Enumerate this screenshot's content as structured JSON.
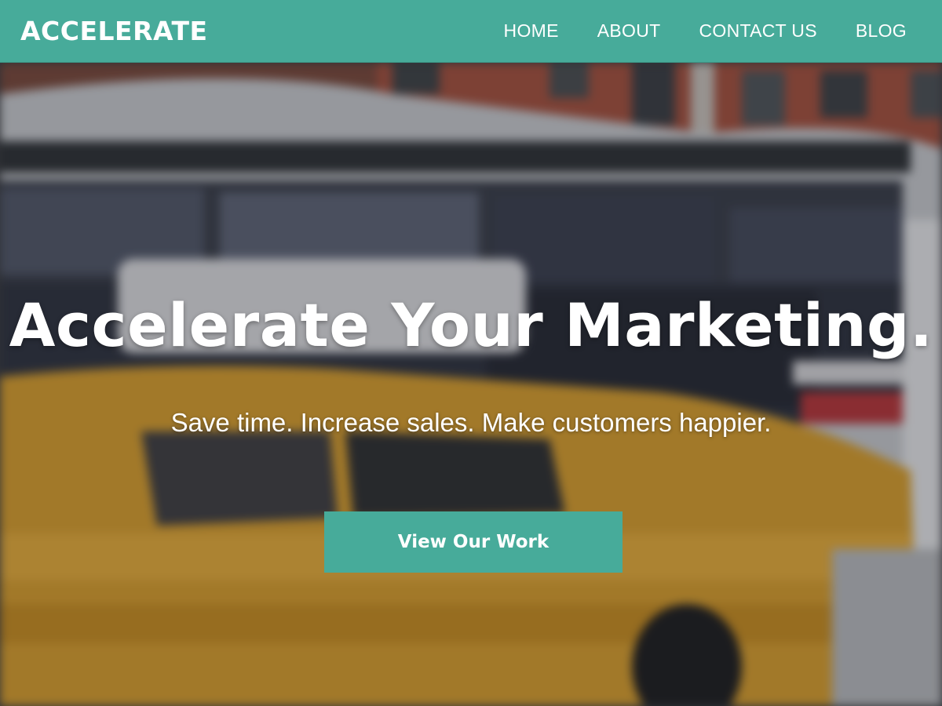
{
  "header": {
    "logo_text": "ACCELERATE",
    "nav": [
      {
        "label": "HOME"
      },
      {
        "label": "ABOUT"
      },
      {
        "label": "CONTACT US"
      },
      {
        "label": "BLOG"
      }
    ]
  },
  "hero": {
    "headline": "Accelerate Your Marketing.",
    "subheadline": "Save time. Increase sales. Make customers happier.",
    "cta_label": "View Our Work",
    "background_description_icon": "street-photo"
  },
  "colors": {
    "brand": "#47ab9a",
    "text": "#ffffff"
  }
}
